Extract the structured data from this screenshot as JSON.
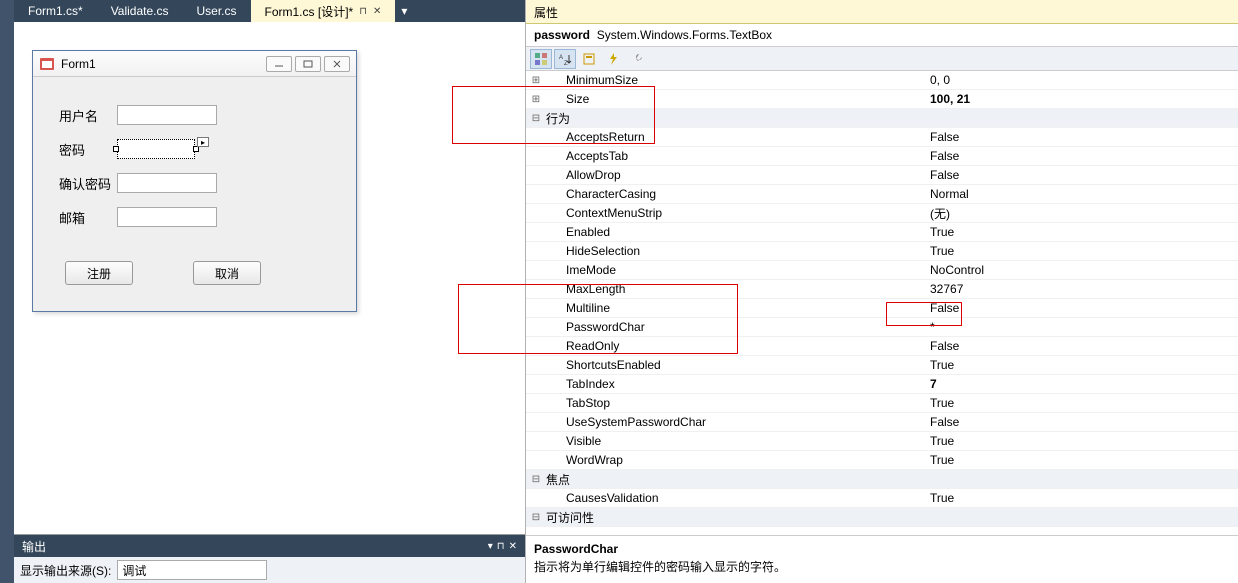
{
  "tabs": [
    {
      "label": "Form1.cs*"
    },
    {
      "label": "Validate.cs"
    },
    {
      "label": "User.cs"
    },
    {
      "label": "Form1.cs [设计]*",
      "active": true
    }
  ],
  "form": {
    "title": "Form1",
    "labels": {
      "user": "用户名",
      "pwd": "密码",
      "confirm": "确认密码",
      "email": "邮箱"
    },
    "buttons": {
      "register": "注册",
      "cancel": "取消"
    }
  },
  "output": {
    "title": "输出",
    "sourceLabel": "显示输出来源(S):",
    "sourceValue": "调试"
  },
  "props": {
    "panelTitle": "属性",
    "objName": "password",
    "objType": "System.Windows.Forms.TextBox",
    "rows": [
      {
        "expand": "⊞",
        "name": "MinimumSize",
        "val": "0, 0"
      },
      {
        "expand": "⊞",
        "name": "Size",
        "val": "100, 21",
        "bold": true
      },
      {
        "cat": true,
        "expand": "⊟",
        "name": "行为"
      },
      {
        "name": "AcceptsReturn",
        "val": "False"
      },
      {
        "name": "AcceptsTab",
        "val": "False"
      },
      {
        "name": "AllowDrop",
        "val": "False"
      },
      {
        "name": "CharacterCasing",
        "val": "Normal"
      },
      {
        "name": "ContextMenuStrip",
        "val": "(无)"
      },
      {
        "name": "Enabled",
        "val": "True"
      },
      {
        "name": "HideSelection",
        "val": "True"
      },
      {
        "name": "ImeMode",
        "val": "NoControl"
      },
      {
        "name": "MaxLength",
        "val": "32767"
      },
      {
        "name": "Multiline",
        "val": "False"
      },
      {
        "name": "PasswordChar",
        "val": "*"
      },
      {
        "name": "ReadOnly",
        "val": "False"
      },
      {
        "name": "ShortcutsEnabled",
        "val": "True"
      },
      {
        "name": "TabIndex",
        "val": "7",
        "bold": true
      },
      {
        "name": "TabStop",
        "val": "True"
      },
      {
        "name": "UseSystemPasswordChar",
        "val": "False"
      },
      {
        "name": "Visible",
        "val": "True"
      },
      {
        "name": "WordWrap",
        "val": "True"
      },
      {
        "cat": true,
        "expand": "⊟",
        "name": "焦点"
      },
      {
        "name": "CausesValidation",
        "val": "True"
      },
      {
        "cat": true,
        "expand": "⊟",
        "name": "可访问性"
      }
    ],
    "descTitle": "PasswordChar",
    "descText": "指示将为单行编辑控件的密码输入显示的字符。"
  }
}
